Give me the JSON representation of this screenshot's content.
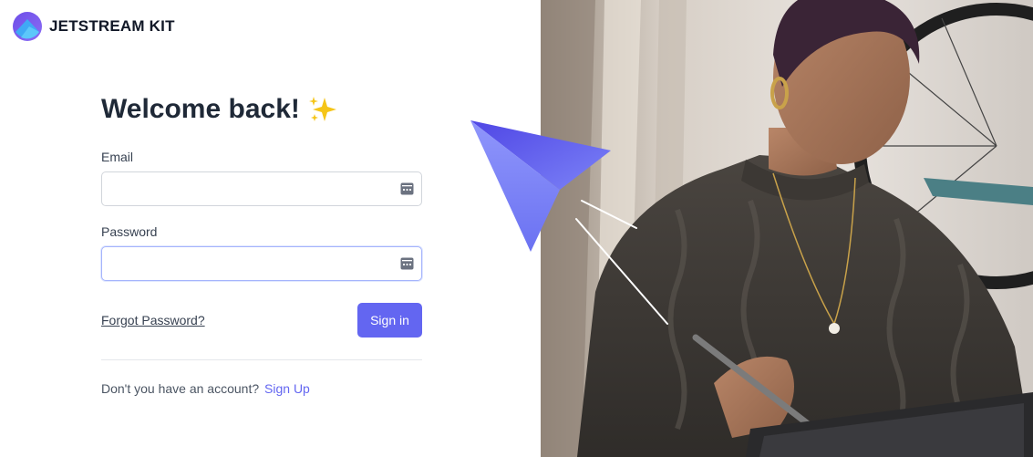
{
  "brand": {
    "name": "JETSTREAM KIT",
    "logo_icon": "jetstream-logo-icon"
  },
  "login": {
    "title": "Welcome back!",
    "title_icon": "sparkles-icon",
    "email_label": "Email",
    "email_value": "",
    "password_label": "Password",
    "password_value": "",
    "autofill_icon": "password-manager-icon",
    "forgot_label": "Forgot Password?",
    "signin_label": "Sign in",
    "signup_prompt": "Don't you have an account?",
    "signup_label": "Sign Up"
  },
  "colors": {
    "accent": "#6366f1",
    "text_dark": "#1f2937",
    "border": "#d1d5db",
    "plane_light": "#818cf8",
    "plane_dark": "#4f46e5"
  }
}
